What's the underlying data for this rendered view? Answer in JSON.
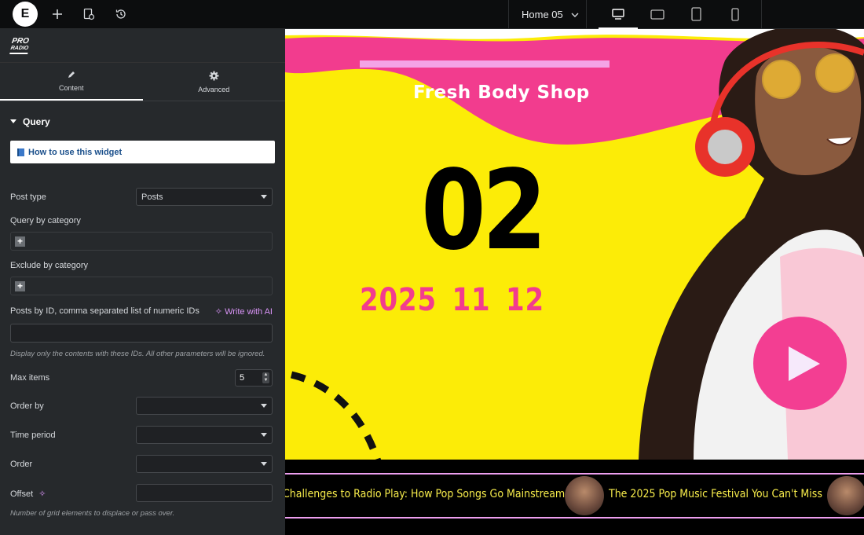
{
  "topbar": {
    "logo_letter": "E",
    "page_name": "Home 05"
  },
  "panel": {
    "brand_line1": "PRO",
    "brand_line2": "RADIO",
    "tabs": [
      {
        "label": "Content",
        "icon": "pencil-icon",
        "active": true
      },
      {
        "label": "Advanced",
        "icon": "gear-icon",
        "active": false
      }
    ],
    "section_title": "Query",
    "howto_label": "How to use this widget",
    "post_type_label": "Post type",
    "post_type_value": "Posts",
    "query_by_category_label": "Query by category",
    "exclude_by_category_label": "Exclude by category",
    "posts_by_id_label": "Posts by ID, comma separated list of numeric IDs",
    "write_with_ai": "Write with AI",
    "posts_by_id_hint": "Display only the contents with these IDs. All other parameters will be ignored.",
    "max_items_label": "Max items",
    "max_items_value": "5",
    "order_by_label": "Order by",
    "time_period_label": "Time period",
    "order_label": "Order",
    "offset_label": "Offset",
    "offset_hint": "Number of grid elements to displace or pass over."
  },
  "canvas": {
    "headline": "Fresh Body Shop",
    "big_number": "02",
    "date_text": "2025 11 12",
    "ticker": [
      "Challenges to Radio Play: How Pop Songs Go Mainstream",
      "The 2025 Pop Music Festival You Can't Miss"
    ],
    "colors": {
      "yellow": "#fcec07",
      "pink": "#f33e92",
      "light_pink": "#ee9ff0",
      "ticker_text": "#f7ec4b"
    }
  }
}
